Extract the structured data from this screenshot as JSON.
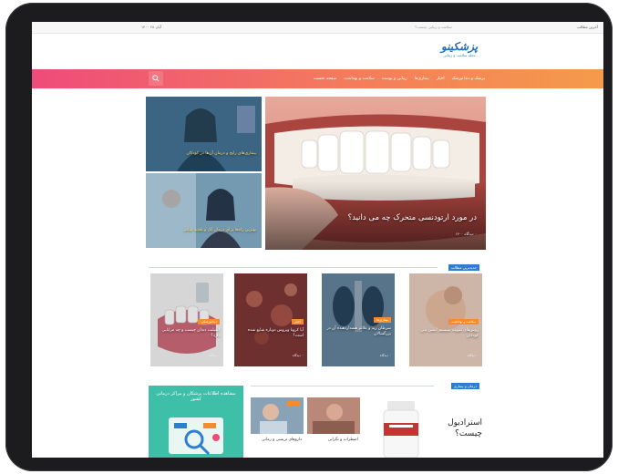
{
  "topbar": {
    "right_text": "آخرین مطالب",
    "middle_text": "سلامت و زیبایی چیست؟",
    "left_text": "۱۴۰۰ آبان ۲۸"
  },
  "logo": {
    "main": "پزشکینو",
    "sub": "مجله سلامت و زیبایی"
  },
  "nav": {
    "items": [
      {
        "label": "صفحه نخست"
      },
      {
        "label": "سلامت و بهداشت"
      },
      {
        "label": "زیبایی و پوست"
      },
      {
        "label": "بیماری‌ها"
      },
      {
        "label": "اخبار"
      },
      {
        "label": "پزشک و دندانپزشک"
      }
    ],
    "search_icon": "search-icon"
  },
  "hero": {
    "title": "در مورد ارتودنسی متحرک چه می دانید؟",
    "meta": "۰ دیدگاه  ۱۴۰۰"
  },
  "side_cards": [
    {
      "title": "بیماری‌های رایج و درمان آن‌ها در کودکان"
    },
    {
      "title": "بهترین راه‌ها برای درمان لک و تغذیه سالم"
    }
  ],
  "section_latest": {
    "title": "جدیدترین مطالب"
  },
  "tiles": [
    {
      "badge": "سلامت و بهداشت",
      "title": "روش‌های تقویت سیستم ایمنی بدن کودکان",
      "meta": "۰ دیدگاه"
    },
    {
      "badge": "بیماری‌ها",
      "title": "سرطان ریه و علائم هشداردهنده آن در بزرگسالان",
      "meta": "۰ دیدگاه"
    },
    {
      "badge": "اخبار",
      "title": "آیا کرونا ویروس دوباره شایع شده است؟",
      "meta": "۰ دیدگاه"
    },
    {
      "badge": "دندانپزشکی",
      "title": "ایمپلنت دندان چیست و چه مزایایی دارد؟",
      "meta": "۰ دیدگاه"
    }
  ],
  "section_health": {
    "title": "درمان و بیماری"
  },
  "bottom": {
    "headline": "استرادیول چیست؟",
    "card1": "اضطراب و نگرانی",
    "card2": "داروهای تریسی و رمانی",
    "teal_text": "مشاهده اطلاعات پزشکان و مراکز درمانی کشور"
  }
}
